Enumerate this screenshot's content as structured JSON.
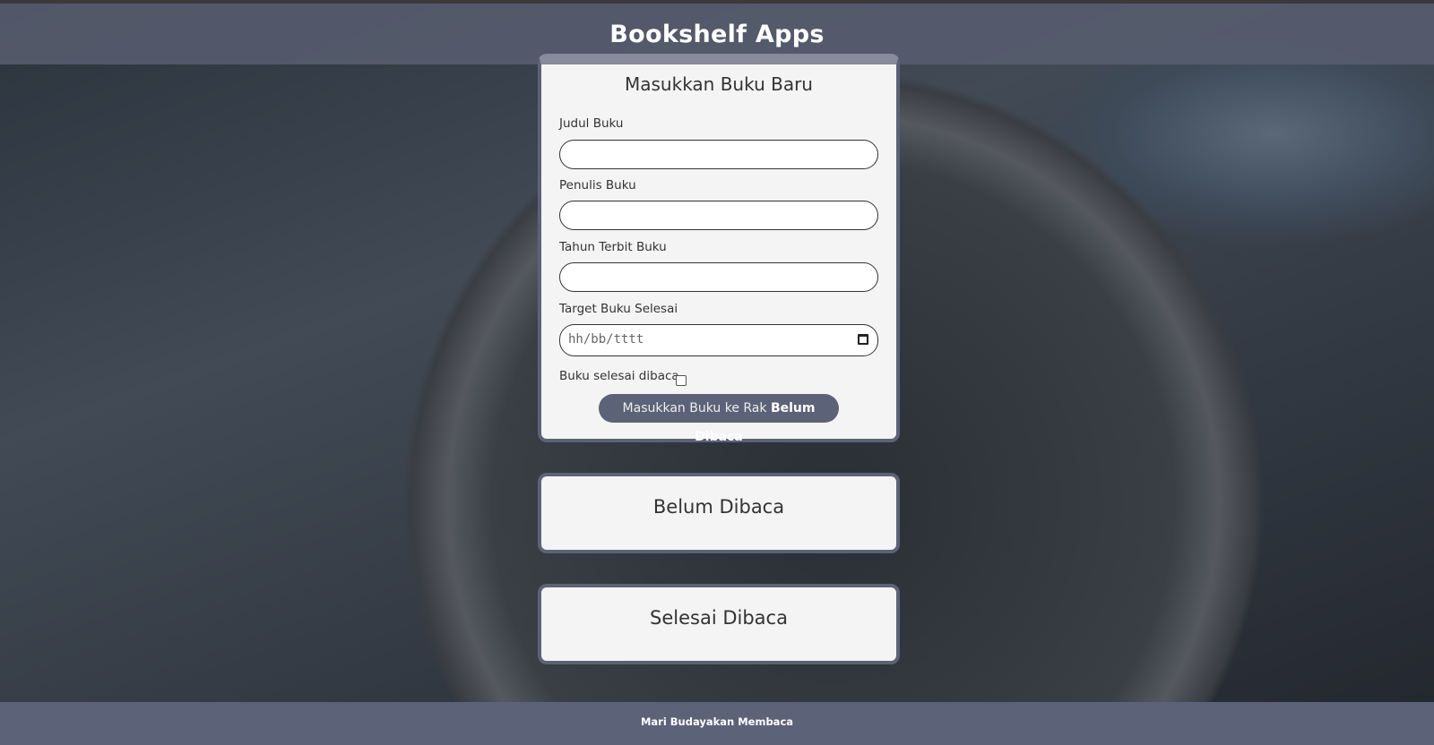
{
  "header": {
    "title": "Bookshelf Apps"
  },
  "form": {
    "title": "Masukkan Buku Baru",
    "title_label": "Judul Buku",
    "author_label": "Penulis Buku",
    "year_label": "Tahun Terbit Buku",
    "target_label": "Target Buku Selesai",
    "date_placeholder": "hh/bb/tttt",
    "complete_label": "Buku selesai dibaca",
    "submit_prefix": "Masukkan Buku ke Rak",
    "submit_shelf": "Belum Dibaca"
  },
  "shelves": {
    "incomplete": "Belum Dibaca",
    "complete": "Selesai Dibaca"
  },
  "footer": {
    "text": "Mari Budayakan Membaca"
  }
}
